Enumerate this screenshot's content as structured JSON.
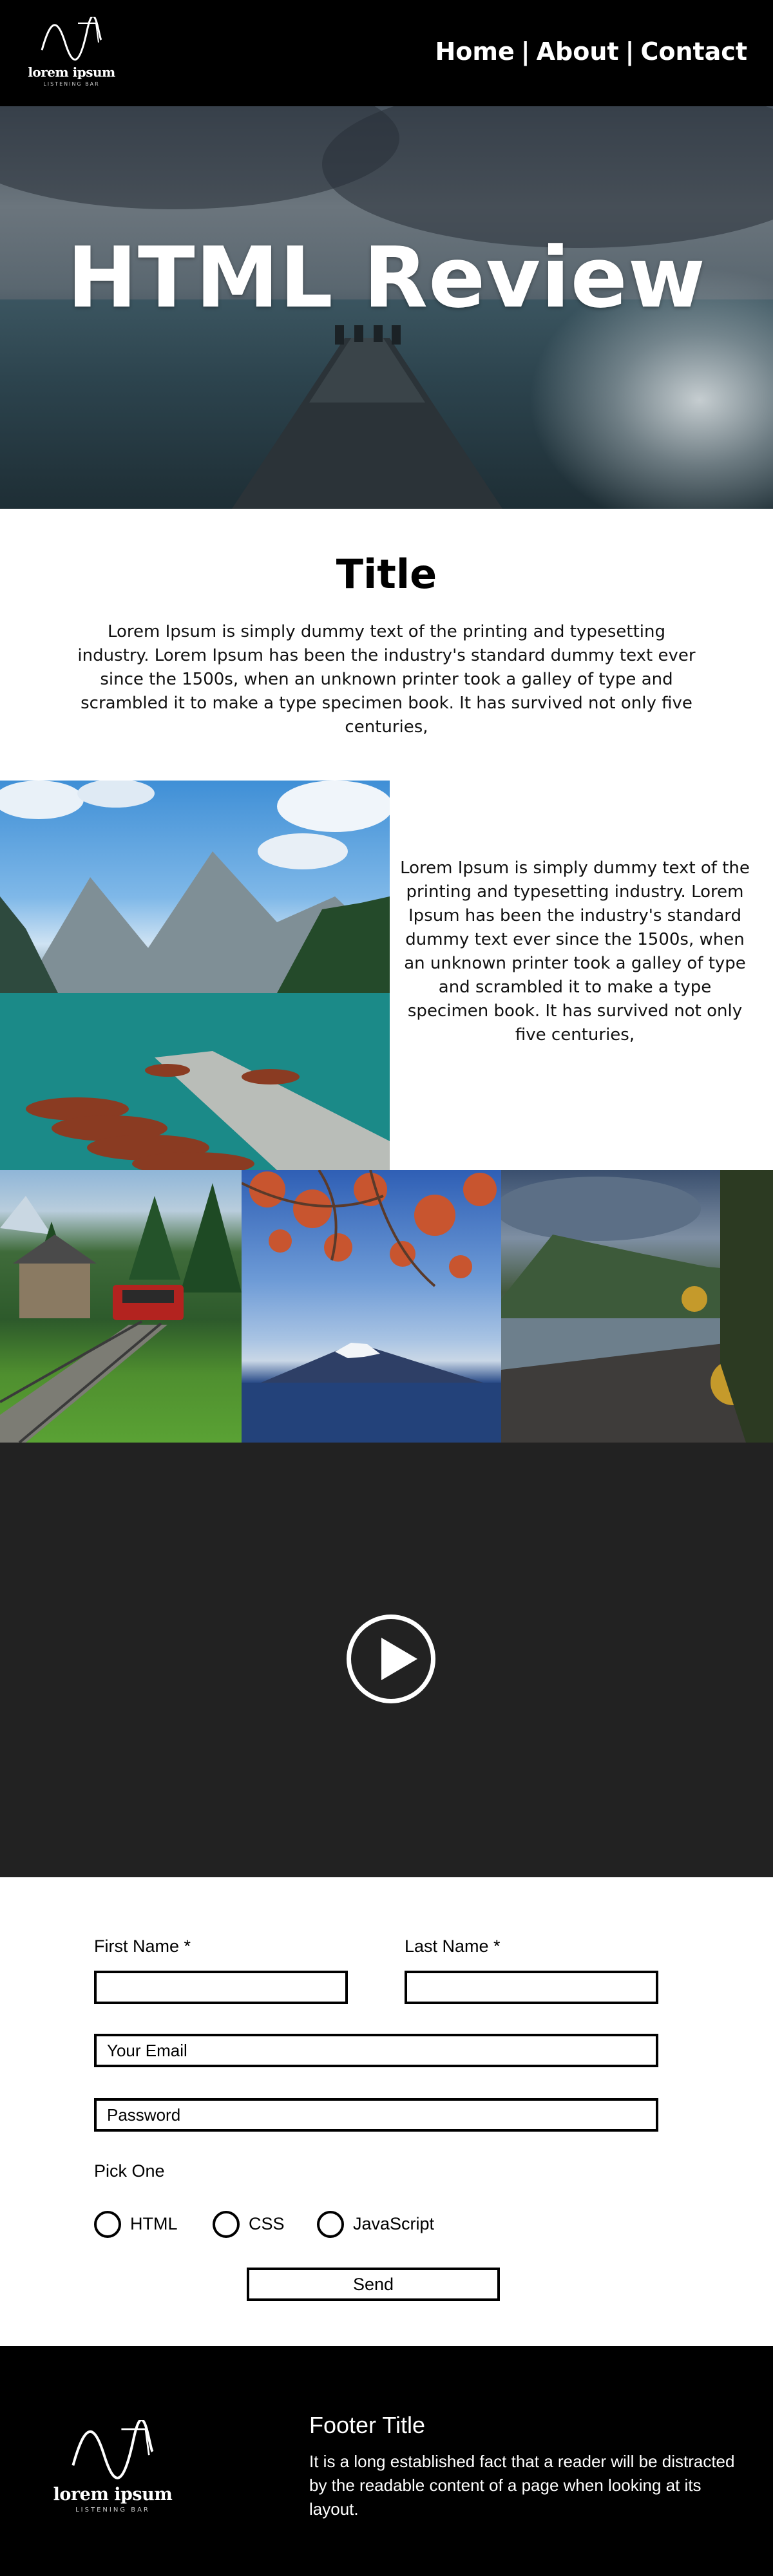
{
  "header": {
    "logo_text": "lorem ipsum",
    "logo_sub": "LISTENING BAR",
    "nav": [
      {
        "label": "Home"
      },
      {
        "label": "About"
      },
      {
        "label": "Contact"
      }
    ],
    "nav_separator": "|"
  },
  "hero": {
    "title": "HTML Review"
  },
  "intro": {
    "title": "Title",
    "text": "Lorem Ipsum is simply dummy text of the printing and typesetting industry. Lorem Ipsum has been the industry's standard dummy text ever since the 1500s, when an unknown printer took a galley of type and scrambled it to make a type specimen book. It has survived not only five centuries,"
  },
  "feature": {
    "text": "Lorem Ipsum is simply dummy text of the printing and typesetting industry. Lorem Ipsum has been the industry's standard dummy text ever since the 1500s, when an unknown printer took a galley of type and scrambled it to make a type specimen book. It has survived not only five centuries,"
  },
  "video": {
    "play_icon": "play-icon"
  },
  "form": {
    "first_name_label": "First Name *",
    "last_name_label": "Last Name *",
    "first_name_value": "",
    "last_name_value": "",
    "email_placeholder": "Your Email",
    "password_placeholder": "Password",
    "pick_one_label": "Pick One",
    "options": [
      {
        "label": "HTML"
      },
      {
        "label": "CSS"
      },
      {
        "label": "JavaScript"
      }
    ],
    "send_label": "Send"
  },
  "footer": {
    "logo_text": "lorem ipsum",
    "logo_sub": "LISTENING BAR",
    "title": "Footer Title",
    "text": "It is a long established fact that a reader will be distracted by the readable content of a page when looking at its layout."
  }
}
